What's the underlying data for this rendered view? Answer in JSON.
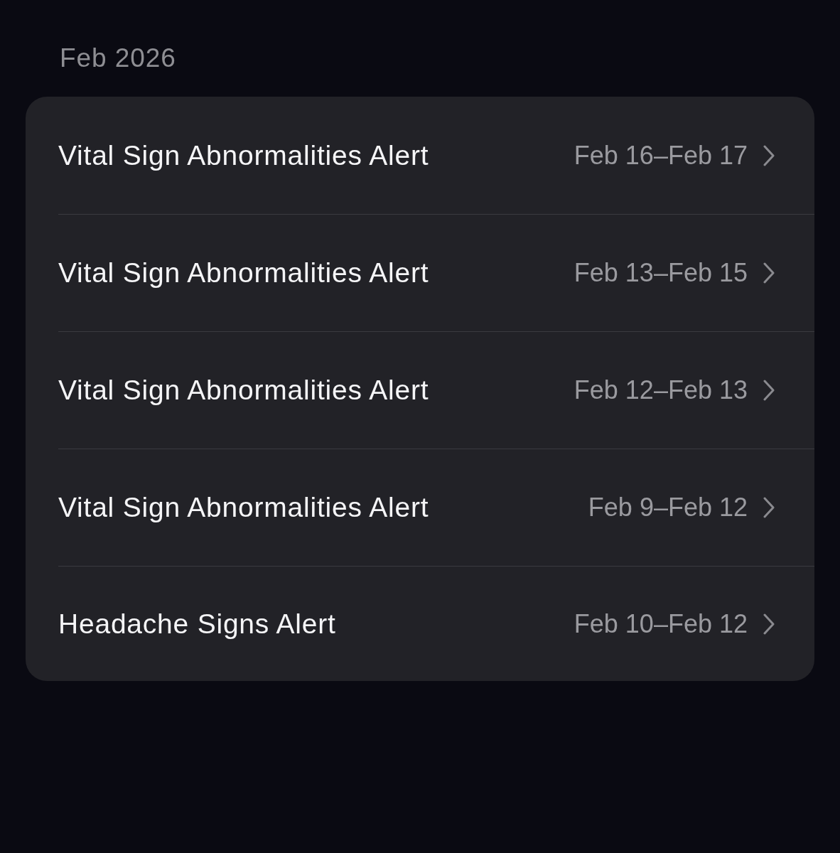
{
  "section": {
    "title": "Feb 2026"
  },
  "alerts": [
    {
      "title": "Vital Sign Abnormalities Alert",
      "dates": "Feb 16–Feb 17"
    },
    {
      "title": "Vital Sign Abnormalities Alert",
      "dates": "Feb 13–Feb 15"
    },
    {
      "title": "Vital Sign Abnormalities Alert",
      "dates": "Feb 12–Feb 13"
    },
    {
      "title": "Vital Sign Abnormalities Alert",
      "dates": "Feb 9–Feb 12"
    },
    {
      "title": "Headache Signs Alert",
      "dates": "Feb 10–Feb 12"
    }
  ]
}
